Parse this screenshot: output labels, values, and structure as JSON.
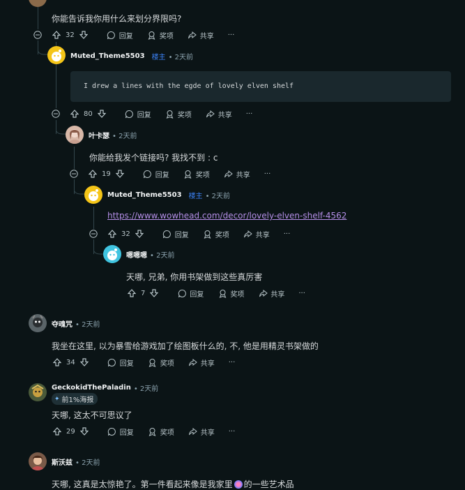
{
  "comments": [
    {
      "id": "c0",
      "text": "你能告诉我你用什么来划分界限吗?",
      "votes": "32"
    },
    {
      "id": "c1",
      "author": "Muted_Theme5503",
      "op_badge": "楼主",
      "time": "• 2天前",
      "code": "I drew a lines with the egde of lovely elven shelf",
      "votes": "80"
    },
    {
      "id": "c2",
      "author": "叶卡瑟",
      "time": "• 2天前",
      "text": "你能给我发个链接吗? 我找不到 : c",
      "votes": "19"
    },
    {
      "id": "c3",
      "author": "Muted_Theme5503",
      "op_badge": "楼主",
      "time": "• 2天前",
      "link": "https://www.wowhead.com/decor/lovely-elven-shelf-4562",
      "votes": "32"
    },
    {
      "id": "c4",
      "author": "嗯嗯嗯",
      "time": "• 2天前",
      "text": "天哪, 兄弟, 你用书架做到这些真厉害",
      "votes": "7"
    },
    {
      "id": "c5",
      "author": "夺魂咒",
      "time": "• 2天前",
      "text": "我坐在这里, 以为暴雪给游戏加了绘图板什么的, 不, 他是用精灵书架做的",
      "votes": "34"
    },
    {
      "id": "c6",
      "author": "GeckokidThePaladin",
      "time": "• 2天前",
      "flair": "前1%海报",
      "text": "天哪, 这太不可思议了",
      "votes": "29"
    },
    {
      "id": "c7",
      "author": "斯沃兹",
      "time": "• 2天前",
      "text": "天哪, 这真是太惊艳了。第一件看起来像是我家里",
      "text_tail": "的一些艺术品"
    }
  ],
  "actions": {
    "reply": "回复",
    "award": "奖项",
    "share": "共享",
    "more": "···"
  },
  "colors": {
    "background": "#0b1416",
    "op": "#3b82f6",
    "link": "#b58fe8",
    "thread_line": "#33464c"
  }
}
